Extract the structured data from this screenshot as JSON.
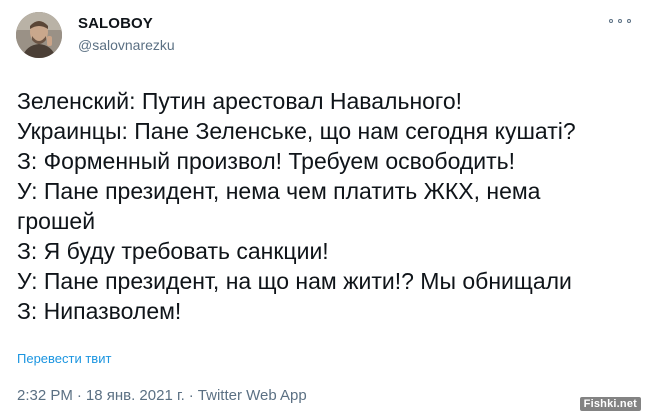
{
  "author": {
    "display_name": "SALOBOY",
    "handle": "@salovnarezku"
  },
  "tweet": {
    "lines": [
      "Зеленский: Путин арестовал Навального!",
      "Украинцы: Пане Зеленське, що нам сегодня кушаті?",
      "З: Форменный произвол! Требуем освободить!",
      "У: Пане президент, нема чем платить ЖКХ, нема",
      "грошей",
      "З: Я буду требовать санкции!",
      "У: Пане президент, на що нам жити!? Мы обнищали",
      "З: Нипазволем!"
    ],
    "translate_label": "Перевести твит"
  },
  "meta": {
    "time": "2:32 PM",
    "separator": "·",
    "date": "18 янв. 2021 г.",
    "source": "Twitter Web App"
  },
  "watermark": "Fishki.net",
  "colors": {
    "text": "#0f1419",
    "secondary": "#5b7083",
    "link": "#1b95e0",
    "background": "#ffffff"
  }
}
